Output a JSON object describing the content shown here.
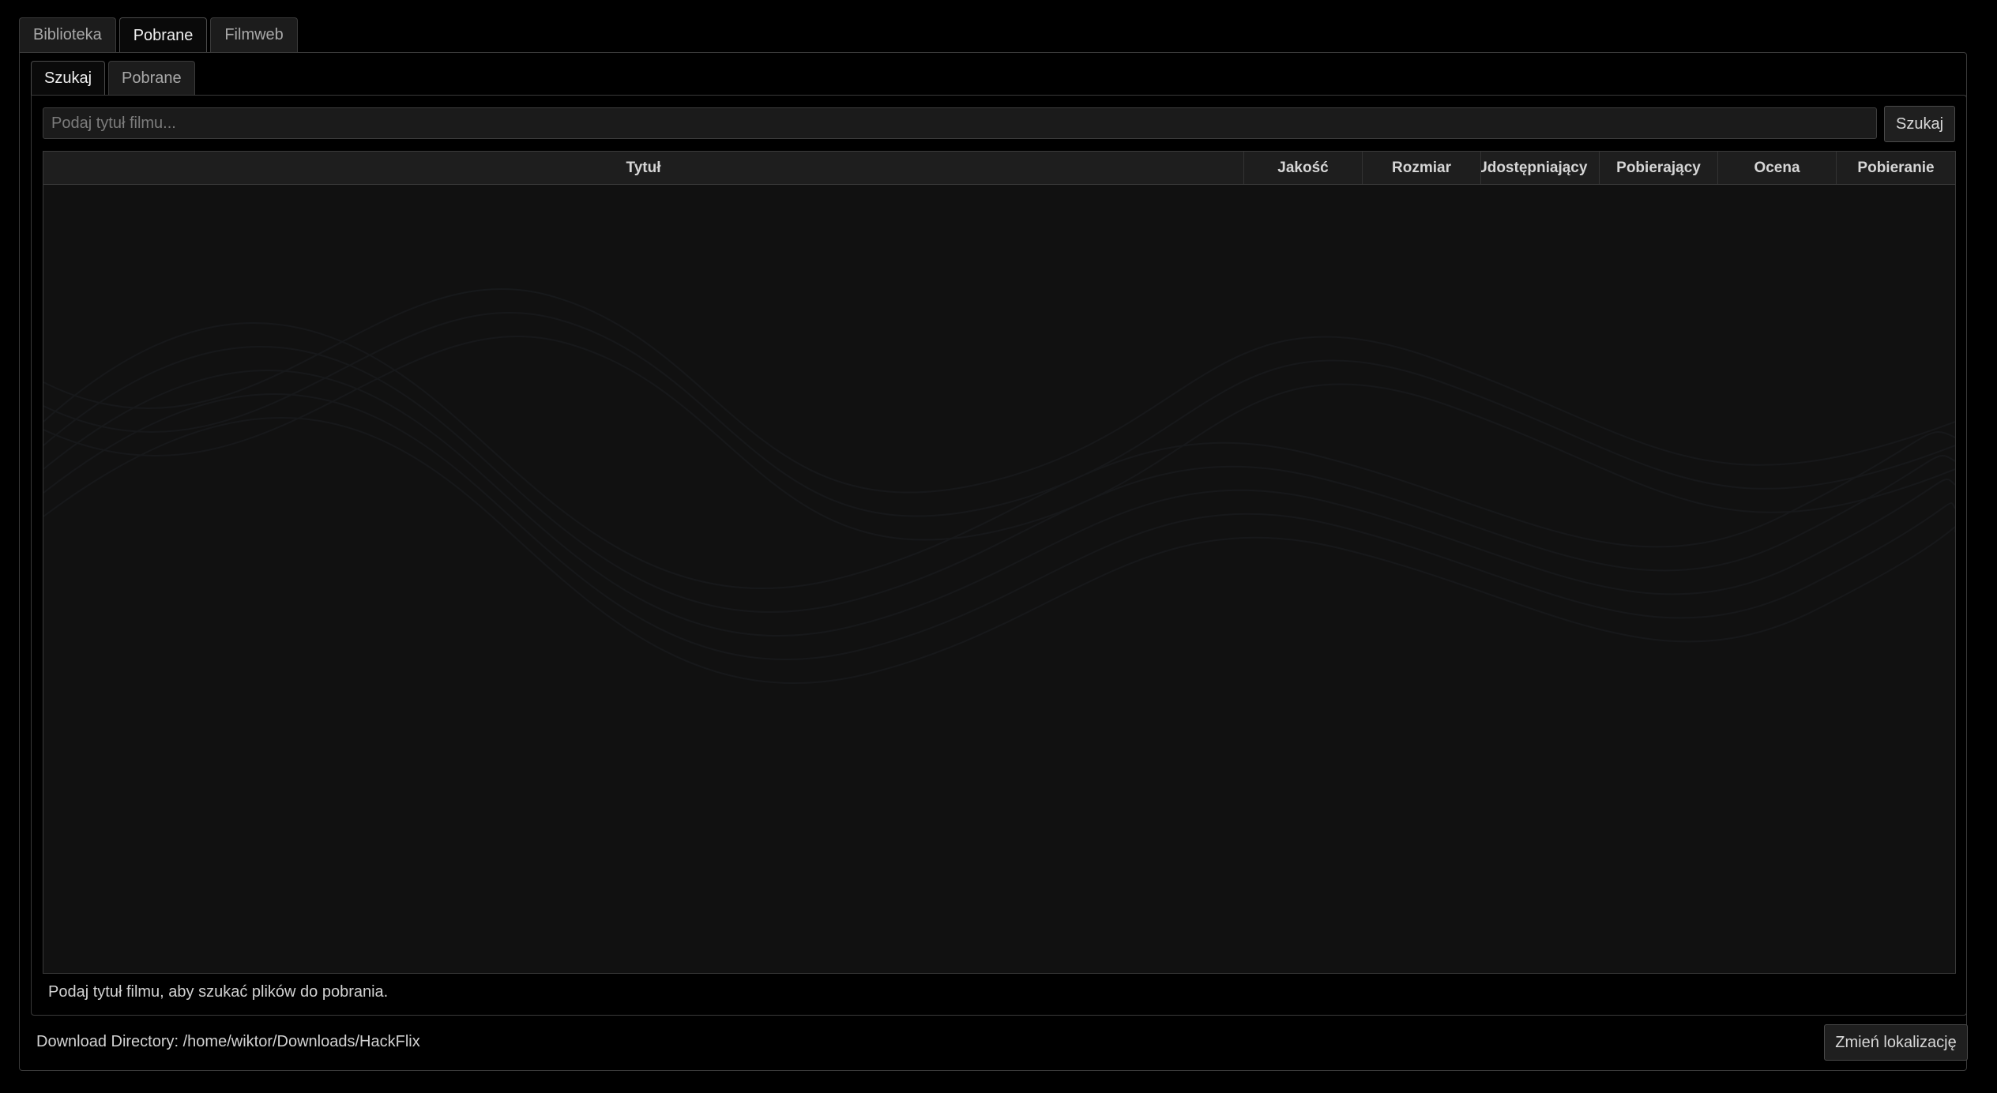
{
  "main_tabs": [
    {
      "label": "Biblioteka",
      "active": false
    },
    {
      "label": "Pobrane",
      "active": true
    },
    {
      "label": "Filmweb",
      "active": false
    }
  ],
  "sub_tabs": [
    {
      "label": "Szukaj",
      "active": true
    },
    {
      "label": "Pobrane",
      "active": false
    }
  ],
  "search": {
    "placeholder": "Podaj tytuł filmu...",
    "value": "",
    "button_label": "Szukaj"
  },
  "table": {
    "columns": [
      "Tytuł",
      "Jakość",
      "Rozmiar",
      "Udostępniający",
      "Pobierający",
      "Ocena",
      "Pobieranie"
    ],
    "rows": []
  },
  "status": {
    "message": "Podaj tytuł filmu, aby szukać plików do pobrania."
  },
  "footer": {
    "download_directory": "Download Directory: /home/wiktor/Downloads/HackFlix",
    "change_location_label": "Zmień lokalizację"
  },
  "colors": {
    "background": "#000000",
    "panel_border": "#3a3a3a",
    "table_background": "#111111",
    "header_background": "#1e1e1e",
    "text": "#d2d2d2"
  }
}
